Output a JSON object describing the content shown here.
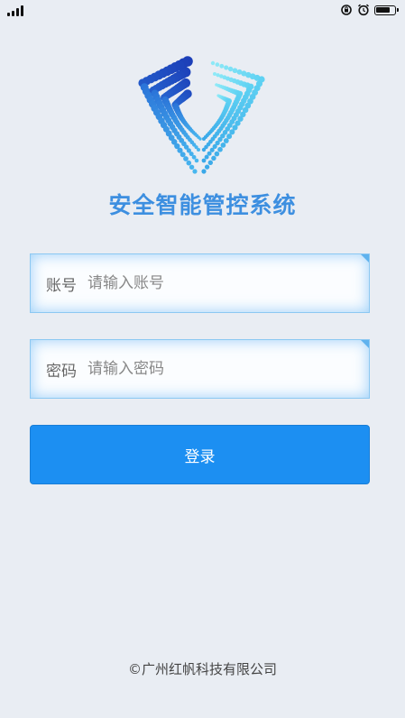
{
  "status_bar": {
    "icons": [
      "signal-icon",
      "rotation-lock-icon",
      "alarm-icon",
      "battery-icon"
    ],
    "battery_level": 0.7
  },
  "app": {
    "title": "安全智能管控系统",
    "logo": "shield-logo"
  },
  "form": {
    "account_label": "账号",
    "account_placeholder": "请输入账号",
    "password_label": "密码",
    "password_placeholder": "请输入密码",
    "login_label": "登录"
  },
  "footer": {
    "copyright": "©广州红帆科技有限公司"
  },
  "colors": {
    "background": "#e9edf3",
    "accent": "#1c8ff2",
    "field_border": "#8cc8f2",
    "title": "#3d8fe0"
  }
}
